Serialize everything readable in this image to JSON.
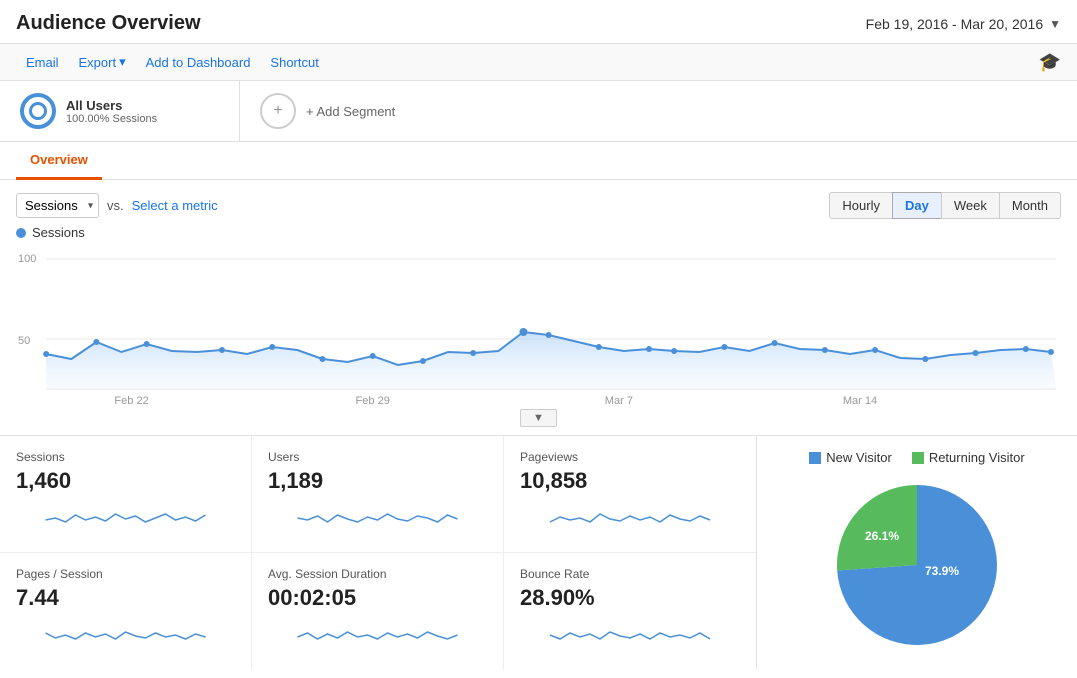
{
  "header": {
    "title": "Audience Overview",
    "dateRange": "Feb 19, 2016 - Mar 20, 2016"
  },
  "toolbar": {
    "email": "Email",
    "export": "Export",
    "addToDashboard": "Add to Dashboard",
    "shortcut": "Shortcut"
  },
  "segments": {
    "allUsers": "All Users",
    "allUsersSub": "100.00% Sessions",
    "addSegment": "+ Add Segment"
  },
  "tabs": [
    {
      "label": "Overview",
      "active": true
    }
  ],
  "chart": {
    "metric": "Sessions",
    "vs": "vs.",
    "selectMetric": "Select a metric",
    "yLabel100": "100",
    "yLabel50": "50",
    "xLabels": [
      "Feb 22",
      "Feb 29",
      "Mar 7",
      "Mar 14"
    ],
    "sessionsDot": "Sessions",
    "timeButtons": [
      "Hourly",
      "Day",
      "Week",
      "Month"
    ],
    "activeTime": "Day"
  },
  "stats": [
    {
      "label": "Sessions",
      "value": "1,460"
    },
    {
      "label": "Users",
      "value": "1,189"
    },
    {
      "label": "Pageviews",
      "value": "10,858"
    },
    {
      "label": "Pages / Session",
      "value": "7.44"
    },
    {
      "label": "Avg. Session Duration",
      "value": "00:02:05"
    },
    {
      "label": "Bounce Rate",
      "value": "28.90%"
    }
  ],
  "pie": {
    "newVisitor": {
      "label": "New Visitor",
      "color": "#4a90d9",
      "percent": 73.9,
      "displayPercent": "73.9%"
    },
    "returningVisitor": {
      "label": "Returning Visitor",
      "color": "#57bb5d",
      "percent": 26.1,
      "displayPercent": "26.1%"
    }
  }
}
